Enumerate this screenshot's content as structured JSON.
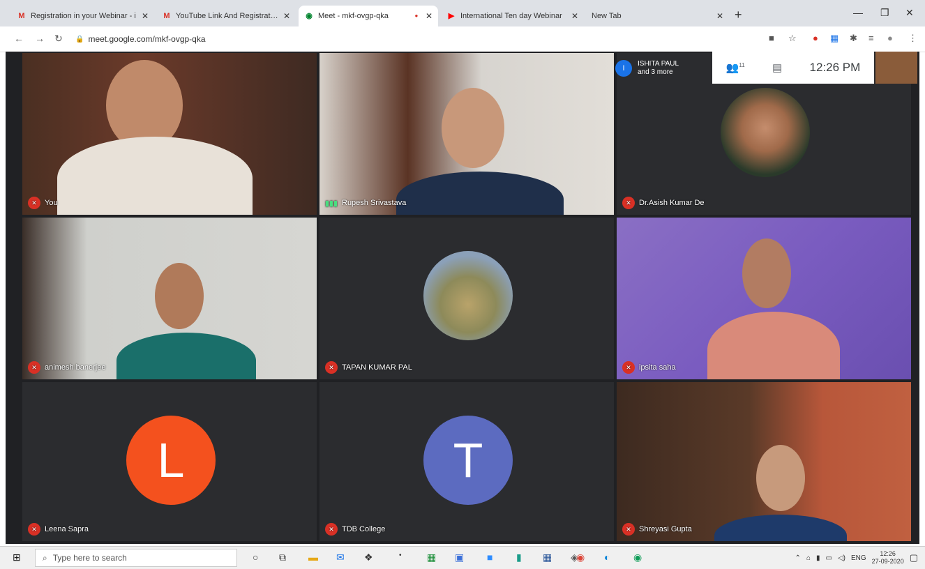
{
  "browser": {
    "tabs": [
      {
        "title": "Registration in your Webinar - i",
        "favicon": "gmail-icon"
      },
      {
        "title": "YouTube Link And Registration",
        "favicon": "gmail-icon"
      },
      {
        "title": "Meet - mkf-ovgp-qka",
        "favicon": "meet-icon"
      },
      {
        "title": "International Ten day Webinar",
        "favicon": "youtube-icon"
      },
      {
        "title": "New Tab",
        "favicon": ""
      }
    ],
    "url": "meet.google.com/mkf-ovgp-qka"
  },
  "meet": {
    "presenter_name": "ISHITA PAUL",
    "presenter_more": "and 3 more",
    "presenter_initial": "I",
    "people_count": "11",
    "time": "12:26 PM",
    "tiles": [
      {
        "name": "You"
      },
      {
        "name": "Rupesh Srivastava"
      },
      {
        "name": "Dr.Asish Kumar De"
      },
      {
        "name": "animesh banerjee"
      },
      {
        "name": "TAPAN KUMAR PAL"
      },
      {
        "name": "ipsita saha"
      },
      {
        "name": "Leena Sapra",
        "initial": "L",
        "color": "#f4511e"
      },
      {
        "name": "TDB College",
        "initial": "T",
        "color": "#5c6bc0"
      },
      {
        "name": "Shreyasi Gupta"
      }
    ]
  },
  "taskbar": {
    "search_placeholder": "Type here to search",
    "lang": "ENG",
    "clock_time": "12:26",
    "clock_date": "27-09-2020"
  }
}
